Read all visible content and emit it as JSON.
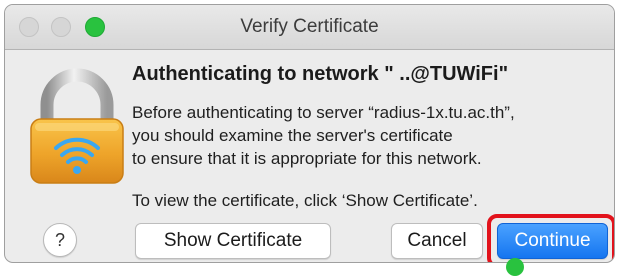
{
  "window": {
    "title": "Verify Certificate",
    "controls": [
      "close",
      "minimize",
      "zoom"
    ]
  },
  "icon": "lock-wifi-icon",
  "dialog": {
    "heading": "Authenticating to network \"     ..@TUWiFi\"",
    "body_lines": [
      "Before authenticating to server “radius-1x.tu.ac.th”,",
      "you should examine the server's certificate",
      "to ensure that it is appropriate for this network."
    ],
    "hint": "To view the certificate, click ‘Show Certificate’."
  },
  "buttons": {
    "help_label": "?",
    "show_certificate_label": "Show Certificate",
    "cancel_label": "Cancel",
    "continue_label": "Continue"
  },
  "colors": {
    "accent_blue": "#1575f0",
    "highlight_red": "#e2121b",
    "zoom_green": "#29c23f"
  }
}
